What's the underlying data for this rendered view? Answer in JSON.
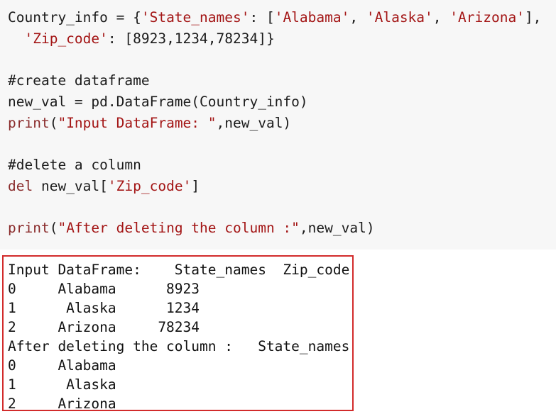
{
  "code": {
    "line1": {
      "pre": "Country_info = {",
      "k1": "'State_names'",
      "mid": ": [",
      "v1": "'Alabama'",
      "sep1": ", ",
      "v2": "'Alaska'",
      "sep2": ", ",
      "v3": "'Arizona'",
      "post": "],"
    },
    "line2": {
      "indent": "  ",
      "k2": "'Zip_code'",
      "post": ": [8923,1234,78234]}"
    },
    "line3": {
      "text": "#create dataframe"
    },
    "line4": {
      "text": "new_val = pd.DataFrame(Country_info)"
    },
    "line5": {
      "fn": "print",
      "open": "(",
      "str": "\"Input DataFrame: \"",
      "post": ",new_val)"
    },
    "line6": {
      "text": "#delete a column"
    },
    "line7": {
      "kw": "del",
      "mid": " new_val[",
      "str": "'Zip_code'",
      "post": "]"
    },
    "line8": {
      "fn": "print",
      "open": "(",
      "str": "\"After deleting the column :\"",
      "post": ",new_val)"
    }
  },
  "output": {
    "lines": [
      "Input DataFrame:    State_names  Zip_code",
      "0     Alabama      8923",
      "1      Alaska      1234",
      "2     Arizona     78234",
      "After deleting the column :   State_names",
      "0     Alabama",
      "1      Alaska",
      "2     Arizona"
    ]
  }
}
